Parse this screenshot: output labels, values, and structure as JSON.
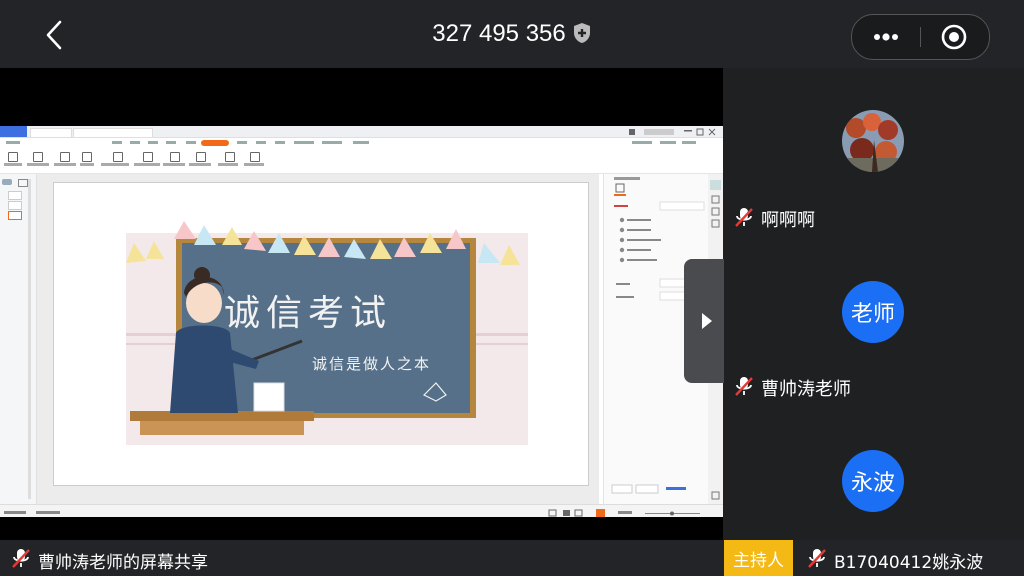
{
  "meeting": {
    "id": "327 495 356"
  },
  "gallery": {
    "participants": [
      {
        "name": "啊啊啊",
        "avatar": "photo"
      },
      {
        "name": "曹帅涛老师",
        "avatar_text": "老师"
      },
      {
        "avatar_text": "永波"
      }
    ]
  },
  "bottom": {
    "share_label": "曹帅涛老师的屏幕共享",
    "host_badge": "主持人",
    "host_name": "B17040412姚永波"
  },
  "slide": {
    "title": "诚信考试",
    "subtitle": "诚信是做人之本"
  },
  "colors": {
    "accent_blue": "#1b6ff5",
    "host_yellow": "#f5b915",
    "wps_orange": "#f06a1a"
  }
}
